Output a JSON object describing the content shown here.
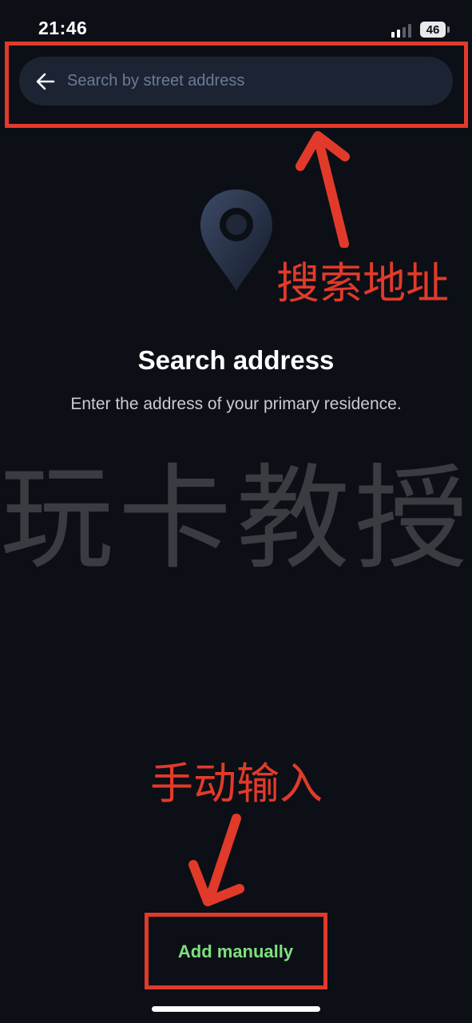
{
  "status_bar": {
    "time": "21:46",
    "battery": "46",
    "signal_icon": "signal-bars-icon"
  },
  "search": {
    "placeholder": "Search by street address",
    "value": "",
    "back_icon": "arrow-left-icon"
  },
  "main": {
    "icon": "map-pin-icon",
    "title": "Search address",
    "subtitle": "Enter the address of your primary residence."
  },
  "watermark": "玩卡教授",
  "annotations": {
    "search_label": "搜索地址",
    "manual_label": "手动输入",
    "color": "#e23a2a"
  },
  "footer": {
    "add_manually_label": "Add manually",
    "accent_color": "#7fe07d"
  },
  "colors": {
    "background": "#0c0f16",
    "search_bar": "#1c2433",
    "placeholder": "#6b7b98"
  }
}
